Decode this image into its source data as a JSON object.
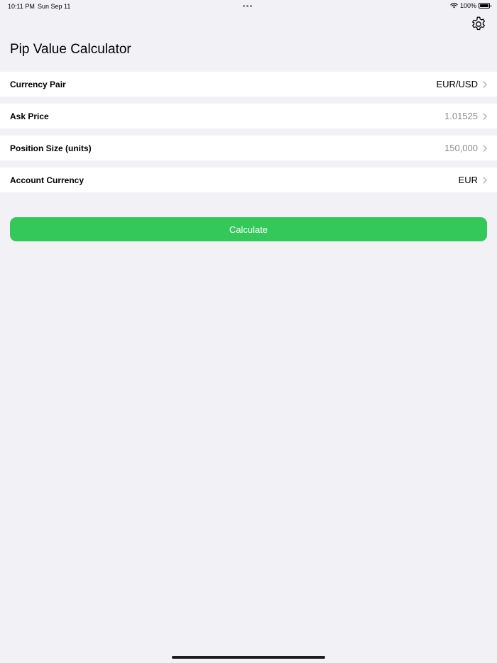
{
  "status_bar": {
    "time": "10:11 PM",
    "date": "Sun Sep 11",
    "battery": "100%"
  },
  "header": {
    "title": "Pip Value Calculator",
    "settings_icon": "gear-icon"
  },
  "form": {
    "rows": [
      {
        "label": "Currency Pair",
        "value": "EUR/USD",
        "muted": false
      },
      {
        "label": "Ask Price",
        "value": "1.01525",
        "muted": true
      },
      {
        "label": "Position Size (units)",
        "value": "150,000",
        "muted": true
      },
      {
        "label": "Account Currency",
        "value": "EUR",
        "muted": false
      }
    ]
  },
  "actions": {
    "calculate_label": "Calculate"
  },
  "colors": {
    "background": "#f2f1f6",
    "accent_green": "#34c85a",
    "muted_text": "#8b8b90"
  }
}
